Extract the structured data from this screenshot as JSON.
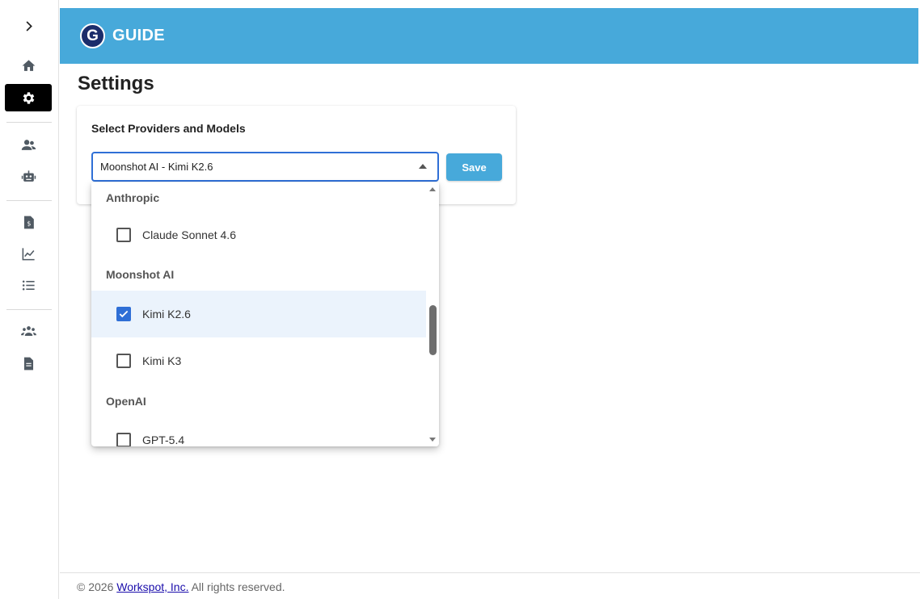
{
  "sidebar": {
    "items": [
      {
        "name": "expand",
        "icon": "chevron-right-icon"
      },
      {
        "name": "home",
        "icon": "home-icon"
      },
      {
        "name": "settings",
        "icon": "gear-icon",
        "active": true
      },
      {
        "name": "users",
        "icon": "users-icon"
      },
      {
        "name": "agents",
        "icon": "robot-icon"
      },
      {
        "name": "billing",
        "icon": "invoice-icon"
      },
      {
        "name": "analytics",
        "icon": "chart-line-icon"
      },
      {
        "name": "list",
        "icon": "list-icon"
      },
      {
        "name": "groups",
        "icon": "group-icon"
      },
      {
        "name": "documents",
        "icon": "file-icon"
      }
    ]
  },
  "header": {
    "logo_letter": "G",
    "app_name": "GUIDE",
    "color": "#47a9da"
  },
  "page": {
    "title": "Settings"
  },
  "settings_card": {
    "label": "Select Providers and Models",
    "select_value": "Moonshot AI - Kimi K2.6",
    "save_label": "Save"
  },
  "dropdown": {
    "groups": [
      {
        "label": "Anthropic",
        "options": [
          {
            "label": "Claude Sonnet 4.6",
            "checked": false
          }
        ]
      },
      {
        "label": "Moonshot AI",
        "options": [
          {
            "label": "Kimi K2.6",
            "checked": true
          },
          {
            "label": "Kimi K3",
            "checked": false
          }
        ]
      },
      {
        "label": "OpenAI",
        "options": [
          {
            "label": "GPT-5.4",
            "checked": false
          }
        ]
      }
    ]
  },
  "footer": {
    "prefix": "© 2026 ",
    "link_text": "Workspot, Inc.",
    "suffix": " All rights reserved."
  },
  "colors": {
    "accent": "#47a9da",
    "primary": "#2f6fd6",
    "selected_bg": "#ebf3fc"
  }
}
